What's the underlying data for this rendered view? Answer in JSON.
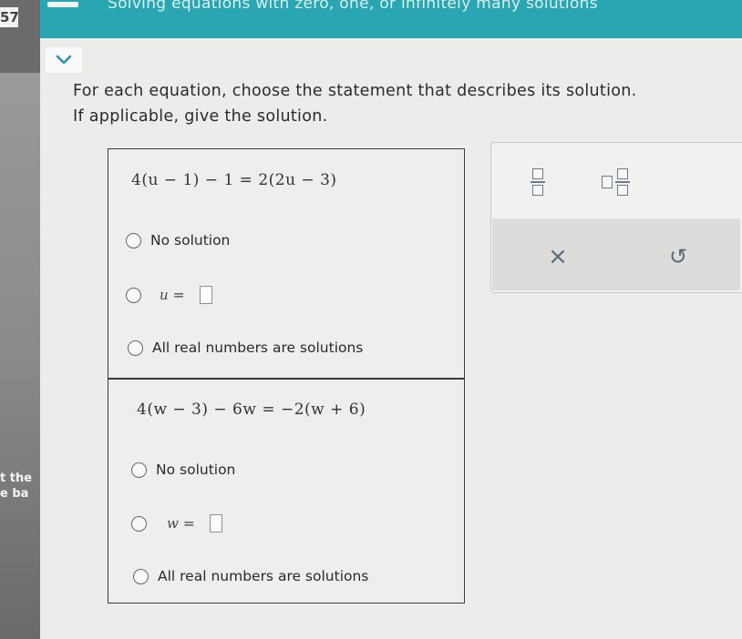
{
  "header": {
    "topic_title": "Solving equations with zero, one, or infinitely many solutions"
  },
  "background_window": {
    "number": "57",
    "text_line1": "t the",
    "text_line2": "e ba"
  },
  "instructions": {
    "line1": "For each equation, choose the statement that describes its solution.",
    "line2": "If applicable, give the solution."
  },
  "questions": [
    {
      "equation": "4(u − 1) − 1 = 2(2u − 3)",
      "variable": "u",
      "options": {
        "no_solution": "No solution",
        "equals_label": "=",
        "all_real": "All real numbers are solutions"
      }
    },
    {
      "equation": "4(w − 3) − 6w = −2(w + 6)",
      "variable": "w",
      "options": {
        "no_solution": "No solution",
        "equals_label": "=",
        "all_real": "All real numbers are solutions"
      }
    }
  ],
  "tools": {
    "fraction_icon": "fraction-icon",
    "mixed_number_icon": "mixed-number-icon",
    "clear_symbol": "×",
    "undo_symbol": "↺"
  },
  "colors": {
    "header": "#2aa6b3",
    "page_background": "#ececea"
  }
}
